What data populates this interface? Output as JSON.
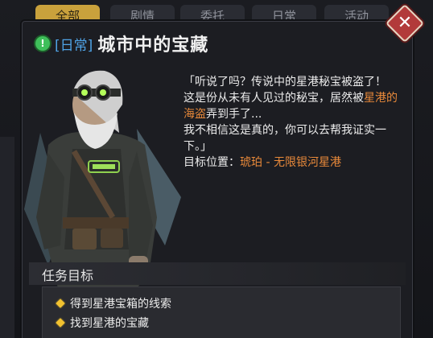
{
  "tabs": [
    {
      "label": "全部",
      "active": true
    },
    {
      "label": "剧情",
      "active": false
    },
    {
      "label": "委托",
      "active": false
    },
    {
      "label": "日常",
      "active": false
    },
    {
      "label": "活动",
      "active": false
    }
  ],
  "quest": {
    "type_icon": "exclamation-icon",
    "tag": "[日常]",
    "title": "城市中的宝藏"
  },
  "dialog": {
    "line1": "「听说了吗？传说中的星港秘宝被盗了！",
    "line2_pre": "这是份从未有人见过的秘宝，居然被",
    "line2_highlight": "星港的海盗",
    "line2_post": "弄到手了...",
    "line3": "我不相信这是真的，你可以去帮我证实一下。」",
    "location_label": "目标位置：",
    "location_value": "琥珀 - 无限银河星港"
  },
  "objectives": {
    "header": "任务目标",
    "items": [
      "得到星港宝箱的线索",
      "找到星港的宝藏"
    ]
  },
  "colors": {
    "accent_tab": "#c9a13c",
    "highlight": "#e8893a",
    "tag": "#4fa3e6",
    "bullet": "#f2c230",
    "close": "#b23a3a"
  },
  "icons": {
    "close": "close-icon",
    "bullet": "diamond-bullet-icon"
  }
}
